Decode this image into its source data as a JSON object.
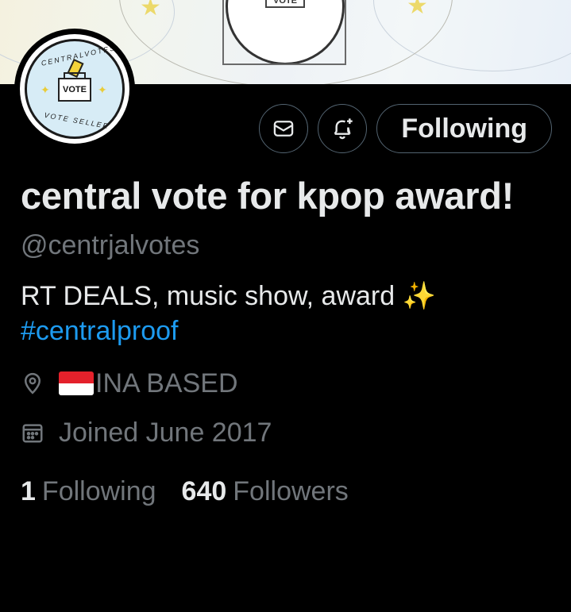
{
  "banner": {
    "vote_tag": "VOTE"
  },
  "avatar": {
    "ballot_label": "VOTE",
    "ring_top": "CENTRALVOTES",
    "ring_bottom": "VOTE SELLER"
  },
  "actions": {
    "message_icon": "envelope-icon",
    "notify_icon": "bell-plus-icon",
    "follow_label": "Following"
  },
  "profile": {
    "name": "central vote for kpop award!",
    "handle": "@centrjalvotes",
    "bio_text": "RT DEALS, music show, award ✨",
    "bio_hashtag": "#centralproof",
    "location": "INA BASED",
    "joined": "Joined June 2017",
    "following_count": "1",
    "following_label": "Following",
    "followers_count": "640",
    "followers_label": "Followers"
  },
  "colors": {
    "background": "#000000",
    "text_primary": "#e7e9ea",
    "text_secondary": "#71767b",
    "link": "#1d9bf0",
    "border": "#536471"
  }
}
